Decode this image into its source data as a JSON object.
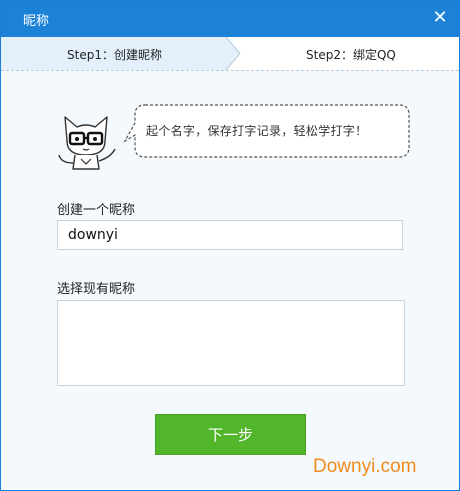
{
  "window": {
    "title": "昵称"
  },
  "steps": {
    "step1": "Step1：创建昵称",
    "step2": "Step2：绑定QQ"
  },
  "bubble": {
    "text": "起个名字，保存打字记录，轻松学打字！"
  },
  "form": {
    "create_label": "创建一个昵称",
    "nickname_value": "downyi",
    "existing_label": "选择现有昵称"
  },
  "buttons": {
    "next": "下一步"
  },
  "watermark": "Downyi.com",
  "colors": {
    "titlebar": "#1b82d8",
    "step_active": "#e3f0fb",
    "next_button": "#52b62b",
    "watermark": "#f08a1d"
  }
}
